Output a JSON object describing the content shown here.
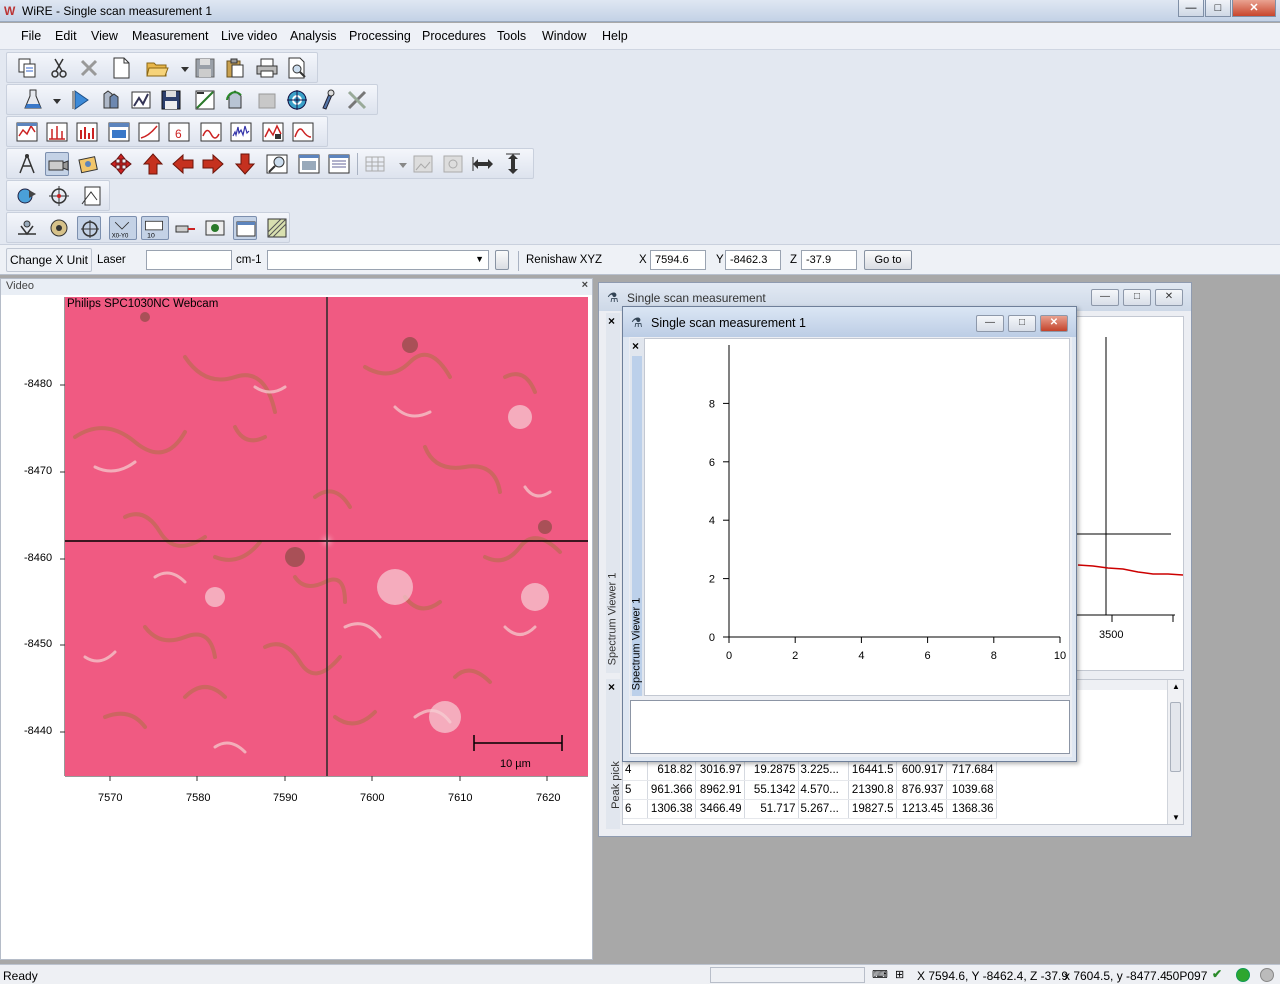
{
  "window": {
    "title": "WiRE - Single scan measurement 1",
    "app_icon": "wire-app-icon",
    "min_label": "—",
    "max_label": "□",
    "close_label": "✕"
  },
  "menu": [
    "File",
    "Edit",
    "View",
    "Measurement",
    "Live video",
    "Analysis",
    "Processing",
    "Procedures",
    "Tools",
    "Window",
    "Help"
  ],
  "properties": {
    "change_x_unit": "Change X Unit",
    "laser_label": "Laser",
    "laser_value": "",
    "unit": "cm-1",
    "dropdown_value": "",
    "stage_label": "Renishaw XYZ",
    "x_label": "X",
    "x_value": "7594.6",
    "y_label": "Y",
    "y_value": "-8462.3",
    "z_label": "Z",
    "z_value": "-37.9",
    "goto_label": "Go to"
  },
  "video": {
    "header": "Video",
    "close": "×",
    "camera_label": "Philips SPC1030NC Webcam",
    "scalebar_label": "10 µm",
    "y_ticks": [
      "-8480",
      "-8470",
      "-8460",
      "-8450",
      "-8440"
    ],
    "x_ticks": [
      "7570",
      "7580",
      "7590",
      "7600",
      "7610",
      "7620"
    ]
  },
  "outer_window": {
    "title": "Single scan measurement",
    "spectrum_viewer_tab": "Spectrum Viewer 1",
    "peak_pick_tab": "Peak pick",
    "partial_x_tick": "3500",
    "close": "×"
  },
  "inner_window": {
    "title": "Single scan measurement 1",
    "spectrum_viewer_tab": "Spectrum Viewer 1",
    "close": "×"
  },
  "peak_table": {
    "rows": [
      [
        "4",
        "618.82",
        "3016.97",
        "19.2875",
        "3.225...",
        "16441.5",
        "600.917",
        "717.684"
      ],
      [
        "5",
        "961.366",
        "8962.91",
        "55.1342",
        "4.570...",
        "21390.8",
        "876.937",
        "1039.68"
      ],
      [
        "6",
        "1306.38",
        "3466.49",
        "51.717",
        "5.267...",
        "19827.5",
        "1213.45",
        "1368.36"
      ]
    ]
  },
  "chart_data": {
    "type": "line",
    "title": "",
    "xlabel": "",
    "ylabel": "",
    "xlim": [
      0,
      10
    ],
    "ylim": [
      0,
      10
    ],
    "x_ticks": [
      "0",
      "2",
      "4",
      "6",
      "8",
      "10"
    ],
    "y_ticks": [
      "0",
      "2",
      "4",
      "6",
      "8"
    ],
    "series": []
  },
  "status": {
    "ready": "Ready",
    "coords": "X 7594.6, Y -8462.4, Z -37.9",
    "cursor": "x 7604.5, y -8477.4",
    "id": "50P097"
  },
  "colors": {
    "spectrum_line": "#cc0000",
    "crosshair": "#000000",
    "sample_bg": "#f05a82",
    "status_green": "#2ea62e"
  }
}
